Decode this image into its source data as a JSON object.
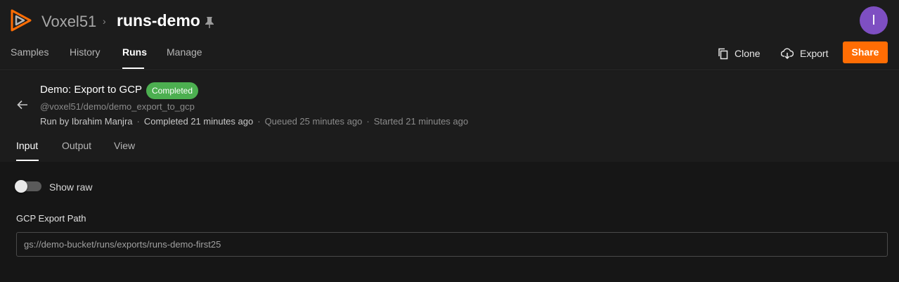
{
  "brand": {
    "org": "Voxel51",
    "dataset": "runs-demo"
  },
  "user": {
    "initial": "I"
  },
  "nav": {
    "tabs": [
      "Samples",
      "History",
      "Runs",
      "Manage"
    ]
  },
  "toolbar": {
    "clone": "Clone",
    "export": "Export",
    "share": "Share"
  },
  "run": {
    "title": "Demo: Export to GCP",
    "status": "Completed",
    "operator": "@voxel51/demo/demo_export_to_gcp",
    "run_by": "Run by Ibrahim Manjra",
    "completed": "Completed 21 minutes ago",
    "queued": "Queued 25 minutes ago",
    "started": "Started 21 minutes ago"
  },
  "run_tabs": [
    "Input",
    "Output",
    "View"
  ],
  "input": {
    "show_raw_label": "Show raw",
    "field_label": "GCP Export Path",
    "field_value": "gs://demo-bucket/runs/exports/runs-demo-first25"
  },
  "colors": {
    "accent": "#ff6d04",
    "status_success": "#4caf50",
    "avatar": "#7e4fc2",
    "background": "#161616"
  },
  "icons": [
    "voxel51-logo-icon",
    "chevron-right-icon",
    "pin-icon",
    "clone-icon",
    "cloud-download-icon",
    "back-arrow-icon"
  ]
}
